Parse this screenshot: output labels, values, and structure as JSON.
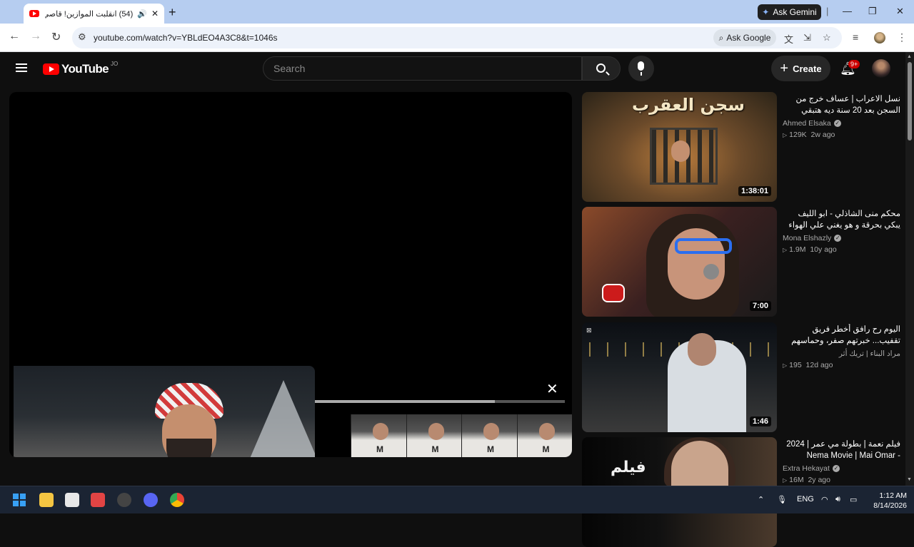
{
  "browser": {
    "tab_title": "(54) انقلبت الموازين! قاصي الـ",
    "tab_speaker": "🔊",
    "gemini_label": "Ask Gemini",
    "url": "youtube.com/watch?v=YBLdEO4A3C8&t=1046s",
    "ask_google": "Ask Google"
  },
  "youtube": {
    "logo_text": "YouTube",
    "country_code": "JO",
    "search_placeholder": "Search",
    "create_label": "Create",
    "notifications_badge": "9+"
  },
  "player": {
    "progress_fraction": 0.72
  },
  "recommendations": [
    {
      "title": "نسل الاعراب | عساف خرج من السجن بعد 20 سنة ديه هتبقي سواد علي الكل",
      "thumbnail_text": "سجن العقرب",
      "channel": "Ahmed Elsaka",
      "verified": true,
      "views": "129K",
      "age": "2w ago",
      "duration": "1:38:01"
    },
    {
      "title": "محكم منى الشاذلي - ابو الليف يبكي بحرقة و هو يغني علي الهواء مباشرة",
      "thumbnail_text": "",
      "channel": "Mona Elshazly",
      "verified": true,
      "views": "1.9M",
      "age": "10y ago",
      "duration": "7:00"
    },
    {
      "title": "اليوم رح رافق أخطر فريق تقفيب... خبرتهم صفر، وحماسهم مليون! 😂⛏️",
      "thumbnail_text": "",
      "channel": "مراد البناء | تريك أثر",
      "verified": false,
      "views": "195",
      "age": "12d ago",
      "duration": "1:46"
    },
    {
      "title": "فيلم نعمة | بطولة مي عمر | 2024 - Nema Movie | Mai Omar",
      "thumbnail_text": "فيلم",
      "channel": "Extra Hekayat",
      "verified": true,
      "views": "16M",
      "age": "2y ago",
      "duration": ""
    }
  ],
  "taskbar": {
    "language": "ENG",
    "time": "1:12 AM",
    "date": "8/14/2026"
  }
}
